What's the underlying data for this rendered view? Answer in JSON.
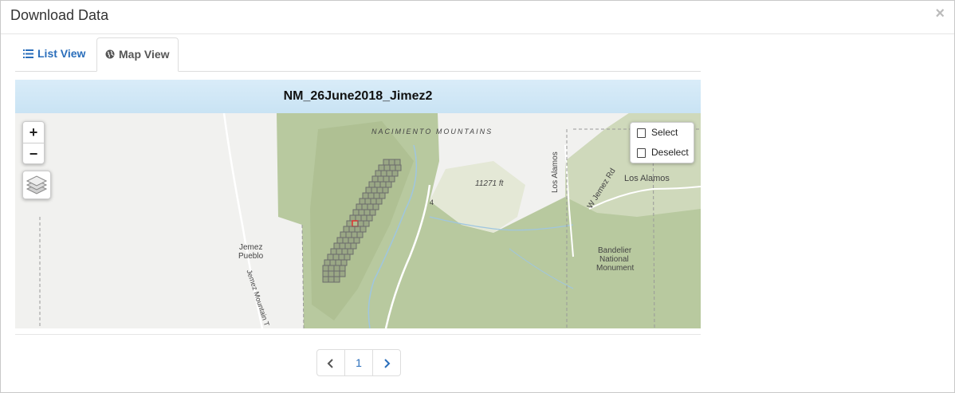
{
  "modal": {
    "title": "Download Data",
    "close_icon": "×"
  },
  "tabs": [
    {
      "label": "List View",
      "icon": "list-icon",
      "active": false
    },
    {
      "label": "Map View",
      "icon": "globe-icon",
      "active": true
    }
  ],
  "map": {
    "dataset_title": "NM_26June2018_Jimez2",
    "zoom_in": "+",
    "zoom_out": "−",
    "layers_icon": "layers-icon",
    "select_label": "Select",
    "deselect_label": "Deselect",
    "labels": {
      "mountains": "NACIMIENTO MOUNTAINS",
      "elevation": "11271 ft",
      "los_alamos_city": "Los Alamos",
      "los_alamos_road": "Los Alamos",
      "jemez_rd": "W Jemez Rd",
      "jemez_pueblo_1": "Jemez",
      "jemez_pueblo_2": "Pueblo",
      "bandelier_1": "Bandelier",
      "bandelier_2": "National",
      "bandelier_3": "Monument",
      "route": "4",
      "mountain_trail": "Jemez Mountain T"
    },
    "colors": {
      "header": "#cfe6f6",
      "forest": "#b9c9a1",
      "grid_tile": "#6b6b6b",
      "selected_tile": "#e03030"
    }
  },
  "pagination": {
    "prev_icon": "chevron-left-icon",
    "page": "1",
    "next_icon": "chevron-right-icon"
  }
}
